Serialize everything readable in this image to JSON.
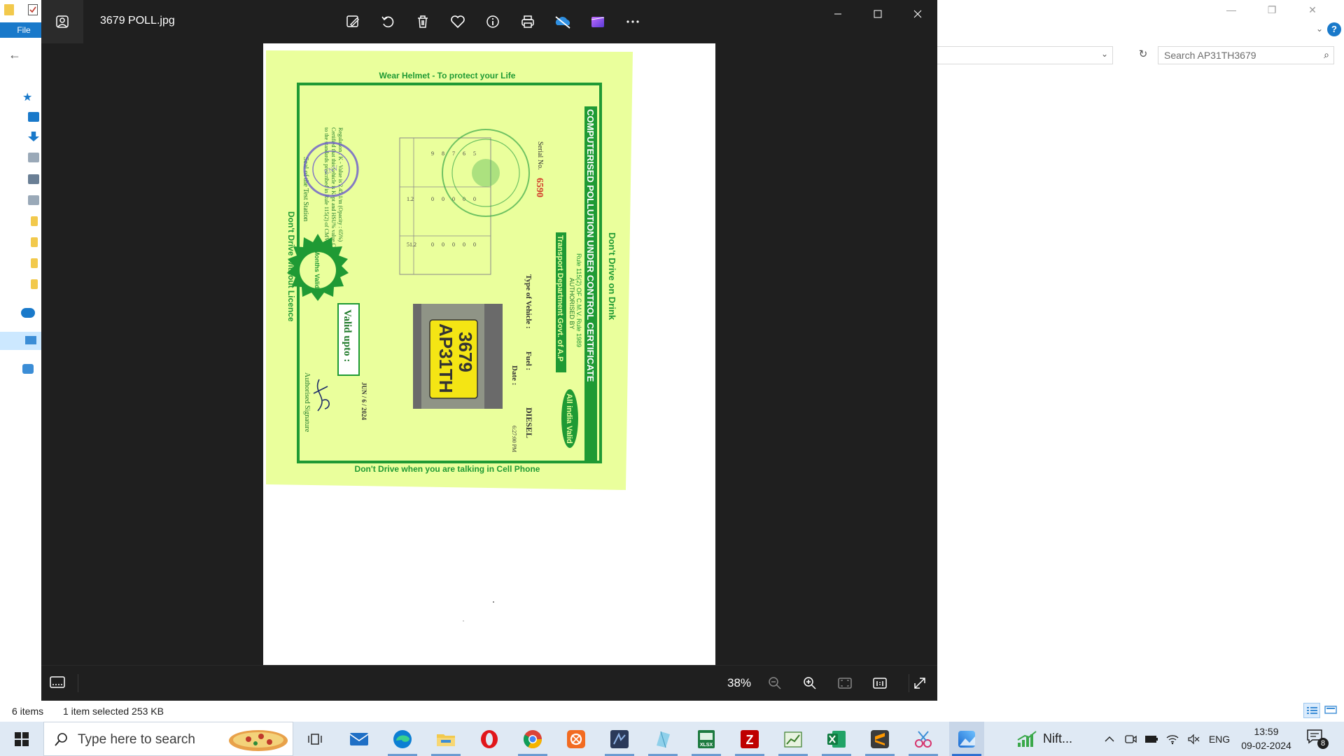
{
  "explorer": {
    "file_tab": "File",
    "search_placeholder": "Search AP31TH3679",
    "status": {
      "item_count": "6 items",
      "selection": "1 item selected  253 KB"
    }
  },
  "viewer": {
    "filename": "3679 POLL.jpg",
    "toolbar": [
      "edit-image",
      "rotate",
      "delete",
      "favorite",
      "info",
      "print",
      "onedrive",
      "video-editor",
      "more"
    ],
    "zoom": "38%",
    "certificate_image": {
      "header": "Wear Helmet - To protect your Life",
      "title": "COMPUTERISED POLLUTION UNDER CONTROL CERTIFICATE",
      "top_slogan": "Don't Drive on Drink",
      "rule": "Rule 115(2) OF C.M.V. Rule 1989",
      "authorised_by": "AUTHORISED BY",
      "department": "Transport Department Govt. of A.P",
      "all_india": "All india Valid",
      "fuel_label": "Fuel :",
      "fuel_value": "DIESEL",
      "date_label": "Date :",
      "valid_upto_label": "Valid upto :",
      "valid_upto_value": "JUN / 6 / 2024",
      "time": "6:27:00 PM",
      "type_label": "Type of Vehicle :",
      "serial_label": "Serial No.",
      "serial_value": "6590",
      "plate_line1": "AP31TH",
      "plate_line2": "3679",
      "validity_badge": "6 Months Validity",
      "left_slogan": "Don't Drive without Licence",
      "bottom_slogan": "Don't Drive when you are talking in Cell Phone",
      "signature_label": "Authorised Signature",
      "seal_label": "Seal of the Test Station"
    }
  },
  "taskbar": {
    "search_placeholder": "Type here to search",
    "nifty_label": "Nift...",
    "language": "ENG",
    "time": "13:59",
    "date": "09-02-2024",
    "notification_count": "8"
  },
  "colors": {
    "viewer_bg": "#1f1f1f",
    "certificate_bg": "#eaff9c",
    "certificate_green": "#1f9a34",
    "explorer_accent": "#1979ca",
    "taskbar_bg": "#dfe9f4"
  }
}
